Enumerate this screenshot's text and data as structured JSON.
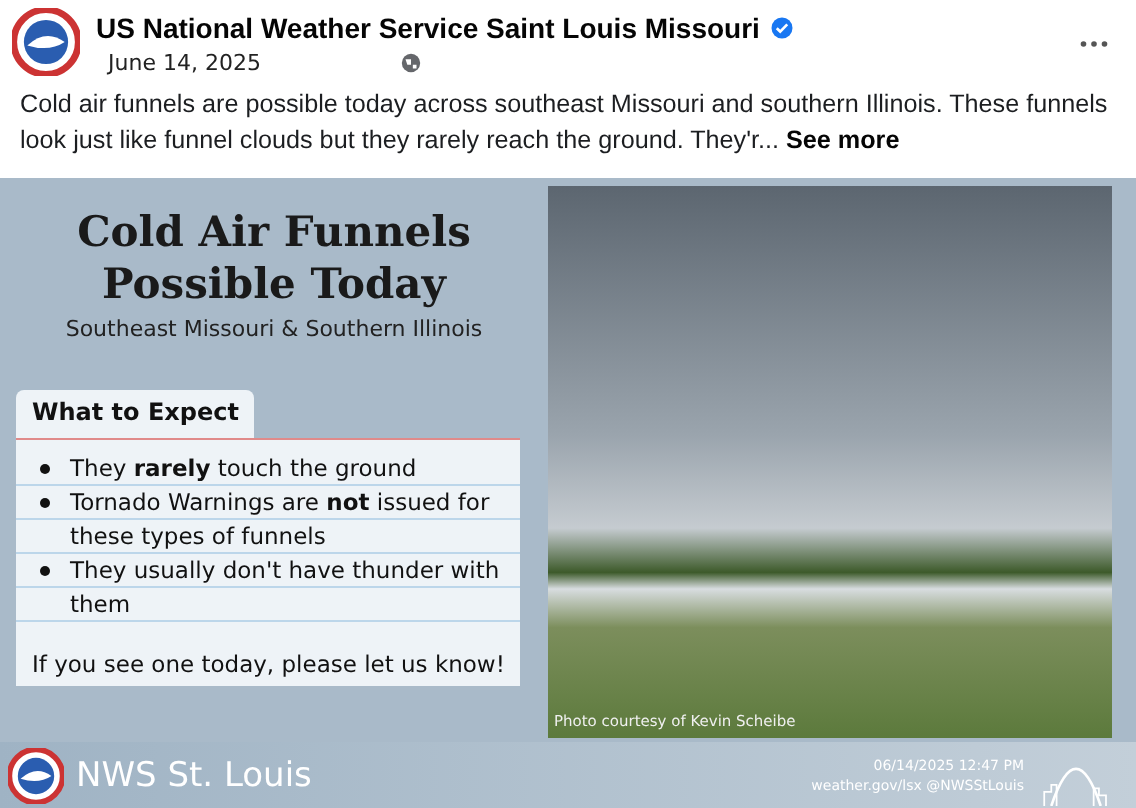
{
  "post": {
    "author": "US National Weather Service Saint Louis Missouri",
    "verified": true,
    "date": "June 14, 2025",
    "text": "Cold air funnels are possible today across southeast Missouri and southern Illinois. These funnels look just like funnel clouds but they rarely reach the ground. They'r...",
    "see_more": "See more"
  },
  "graphic": {
    "title": "Cold Air Funnels Possible Today",
    "subtitle": "Southeast Missouri & Southern Illinois",
    "card_heading": "What to Expect",
    "bullets": [
      "They **rarely** touch the ground",
      "Tornado Warnings are **not** issued for these types of funnels",
      "They usually don't have thunder with them"
    ],
    "closing": "If you see one today, please let us know!",
    "photo_credit": "Photo courtesy of Kevin Scheibe",
    "office": "NWS St. Louis",
    "timestamp": "06/14/2025 12:47 PM",
    "links": "weather.gov/lsx @NWSStLouis"
  }
}
